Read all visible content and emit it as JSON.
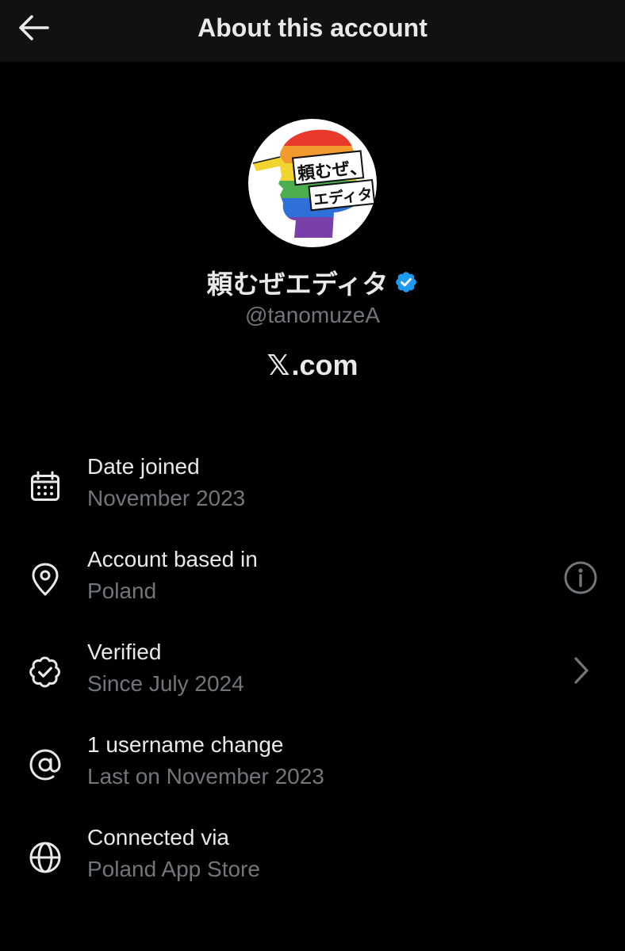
{
  "header": {
    "title": "About this account",
    "back_icon": "arrow-left-icon"
  },
  "profile": {
    "display_name": "頼むぜエディタ",
    "handle": "@tanomuzeA",
    "verified_badge_color": "#1d9bf0",
    "platform": ".com",
    "platform_logo_text": "𝕏",
    "avatar_text_1": "頼むぜ、",
    "avatar_text_2": "エディタ"
  },
  "rows": [
    {
      "icon": "calendar-icon",
      "title": "Date joined",
      "subtitle": "November 2023",
      "action": null
    },
    {
      "icon": "location-pin-icon",
      "title": "Account based in",
      "subtitle": "Poland",
      "action": "info-icon"
    },
    {
      "icon": "verified-badge-icon",
      "title": "Verified",
      "subtitle": "Since July 2024",
      "action": "chevron-right-icon"
    },
    {
      "icon": "at-sign-icon",
      "title": "1 username change",
      "subtitle": "Last on November 2023",
      "action": null
    },
    {
      "icon": "globe-icon",
      "title": "Connected via",
      "subtitle": "Poland App Store",
      "action": null
    }
  ],
  "colors": {
    "background": "#000000",
    "header_background": "#101113",
    "primary_text": "#e7e9ea",
    "secondary_text": "#71767b"
  }
}
